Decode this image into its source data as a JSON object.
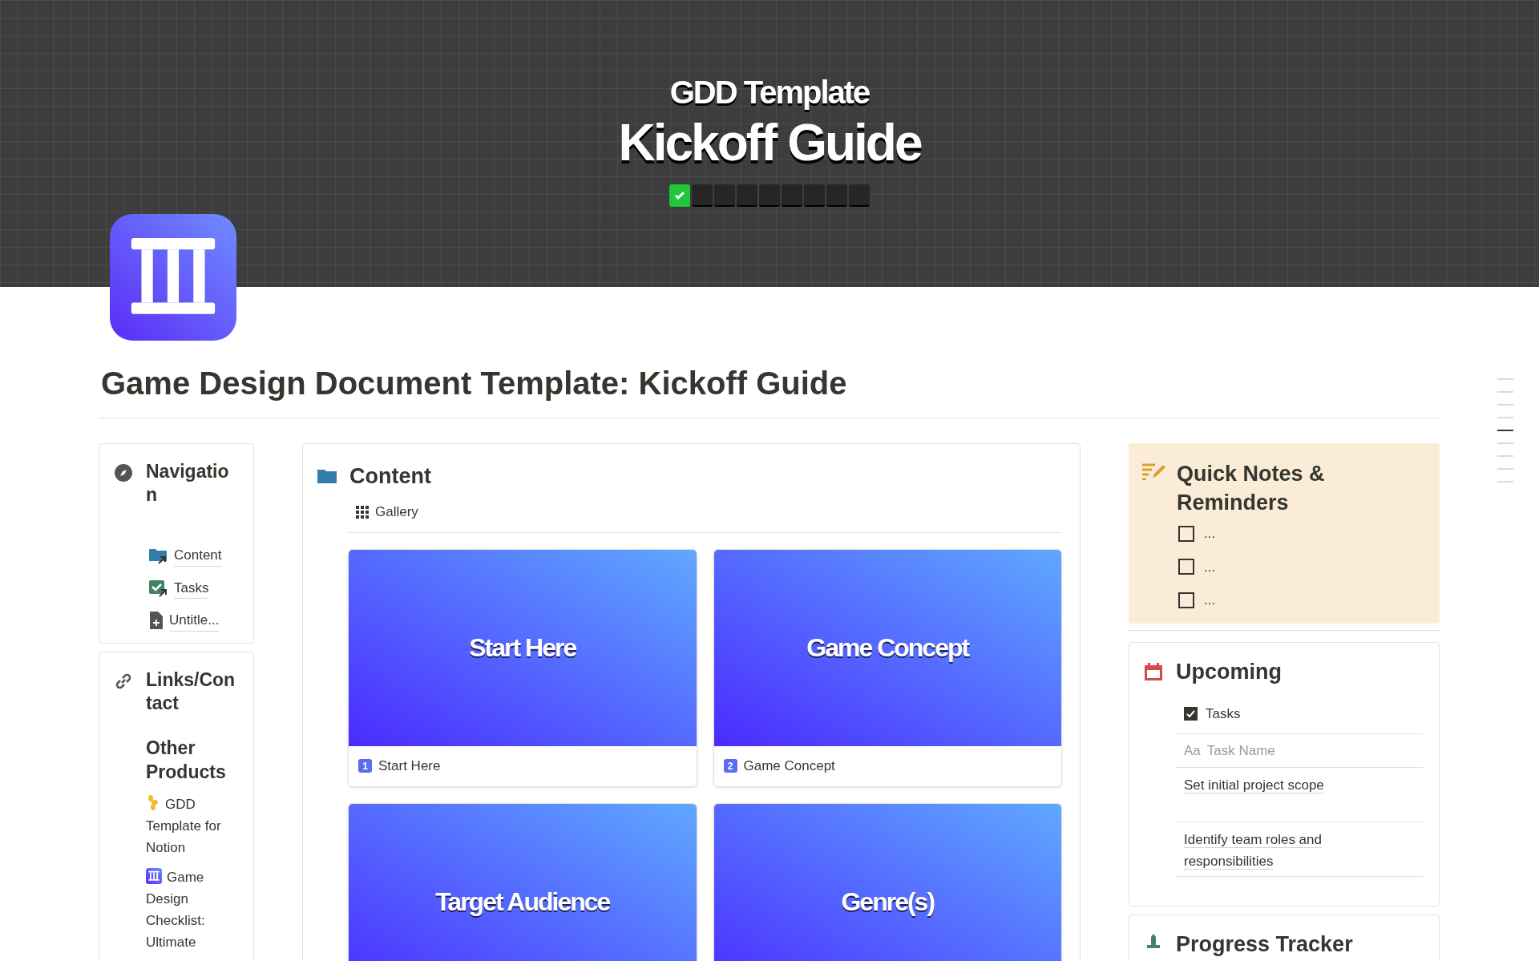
{
  "cover": {
    "subtitle": "GDD Template",
    "title": "Kickoff Guide",
    "steps": [
      {
        "done": true
      },
      {
        "done": false
      },
      {
        "done": false
      },
      {
        "done": false
      },
      {
        "done": false
      },
      {
        "done": false
      },
      {
        "done": false
      },
      {
        "done": false
      },
      {
        "done": false
      }
    ]
  },
  "page_title": "Game Design Document Template: Kickoff Guide",
  "navigation": {
    "title": "Navigation",
    "links": [
      {
        "kind": "folder",
        "label": "Content"
      },
      {
        "kind": "tasks",
        "label": "Tasks"
      },
      {
        "kind": "page",
        "label": "Untitle..."
      }
    ]
  },
  "links_contact": {
    "title": "Links/Contact",
    "subheading": "Other Products",
    "products": [
      {
        "kind": "flower",
        "label": "GDD Template for Notion"
      },
      {
        "kind": "columns",
        "label": "Game Design Checklist: Ultimate"
      }
    ]
  },
  "content": {
    "title": "Content",
    "view": "Gallery",
    "cards": [
      {
        "cover_title": "Start Here",
        "number": "1",
        "label": "Start Here"
      },
      {
        "cover_title": "Game Concept",
        "number": "2",
        "label": "Game Concept"
      },
      {
        "cover_title": "Target Audience"
      },
      {
        "cover_title": "Genre(s)"
      }
    ]
  },
  "quick_notes": {
    "title": "Quick Notes & Reminders",
    "items": [
      {
        "text": "...",
        "checked": false
      },
      {
        "text": "...",
        "checked": false
      },
      {
        "text": "...",
        "checked": false
      }
    ]
  },
  "upcoming": {
    "title": "Upcoming",
    "view": "Tasks",
    "column_icon": "Aa",
    "column": "Task Name",
    "rows": [
      "Set initial project scope",
      "Identify team roles and responsibilities"
    ]
  },
  "progress_tracker": {
    "title": "Progress Tracker"
  },
  "toc": [
    {
      "selected": false
    },
    {
      "selected": false
    },
    {
      "selected": false
    },
    {
      "selected": false
    },
    {
      "selected": true
    },
    {
      "selected": false
    },
    {
      "selected": false
    },
    {
      "selected": false
    },
    {
      "selected": false
    }
  ]
}
